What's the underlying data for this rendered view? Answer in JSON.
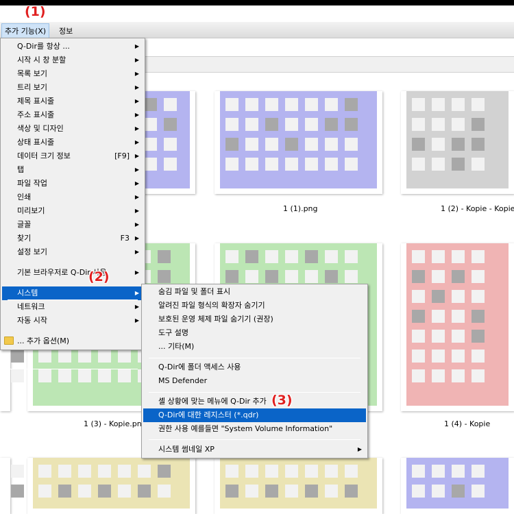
{
  "menubar": {
    "extras_label": "추가 기능(X)",
    "info_label": "정보"
  },
  "badges": {
    "one": "(1)",
    "two": "(2)",
    "three": "(3)"
  },
  "captions": {
    "c1": "1 (1).png",
    "c2": "1 (2) - Kopie - Kopie.",
    "c3": "1 (3) - Kopie.png",
    "c4": "1 (4) - Kopie"
  },
  "main_menu": {
    "items": [
      {
        "label": "Q-Dir를 항상 ...",
        "shortcut": "",
        "arrow": "▶"
      },
      {
        "label": "시작 시 창 분할",
        "shortcut": "",
        "arrow": "▶"
      },
      {
        "label": "목록 보기",
        "shortcut": "",
        "arrow": "▶"
      },
      {
        "label": "트리 보기",
        "shortcut": "",
        "arrow": "▶"
      },
      {
        "label": "제목 표시줄",
        "shortcut": "",
        "arrow": "▶"
      },
      {
        "label": "주소 표시줄",
        "shortcut": "",
        "arrow": "▶"
      },
      {
        "label": "색상 및 디자인",
        "shortcut": "",
        "arrow": "▶"
      },
      {
        "label": "상태 표시줄",
        "shortcut": "",
        "arrow": "▶"
      },
      {
        "label": "데이터 크기 정보",
        "shortcut": "[F9]",
        "arrow": "▶"
      },
      {
        "label": "탭",
        "shortcut": "",
        "arrow": "▶"
      },
      {
        "label": "파일 작업",
        "shortcut": "",
        "arrow": "▶"
      },
      {
        "label": "인쇄",
        "shortcut": "",
        "arrow": "▶"
      },
      {
        "label": "미리보기",
        "shortcut": "",
        "arrow": "▶"
      },
      {
        "label": "글꼴",
        "shortcut": "",
        "arrow": "▶"
      },
      {
        "label": "찾기",
        "shortcut": "F3",
        "arrow": "▶"
      },
      {
        "label": "설정 보기",
        "shortcut": "",
        "arrow": "▶"
      },
      {
        "label": "기본 브라우저로 Q-Dir 사용",
        "shortcut": "",
        "arrow": "▶"
      },
      {
        "label": "시스템",
        "shortcut": "",
        "arrow": "▶"
      },
      {
        "label": "네트워크",
        "shortcut": "",
        "arrow": "▶"
      },
      {
        "label": "자동 시작",
        "shortcut": "",
        "arrow": "▶"
      },
      {
        "label": "... 추가 옵션(M)",
        "shortcut": "",
        "arrow": ""
      }
    ]
  },
  "sub_menu": {
    "items": [
      {
        "label": "숨김 파일 및 폴더 표시",
        "arrow": ""
      },
      {
        "label": "알려진 파일 형식의 확장자 숨기기",
        "arrow": ""
      },
      {
        "label": "보호된 운영 체제 파일 숨기기 (권장)",
        "arrow": ""
      },
      {
        "label": "도구 설명",
        "arrow": ""
      },
      {
        "label": "... 기타(M)",
        "arrow": ""
      },
      {
        "label": "Q-Dir에 폴더 액세스 사용",
        "arrow": ""
      },
      {
        "label": "MS Defender",
        "arrow": ""
      },
      {
        "label": "셸 상황에 맞는 메뉴에 Q-Dir 추가",
        "arrow": ""
      },
      {
        "label": "Q-Dir에 대한 레지스터 (*.qdr)",
        "arrow": ""
      },
      {
        "label": "권한 사용 예를들면 \"System Volume Information\"",
        "arrow": ""
      },
      {
        "label": "시스템 썸네일 XP",
        "arrow": "▶"
      }
    ]
  },
  "colors": {
    "highlight": "#0a64c8",
    "badge": "#e02020",
    "purple": "#b4b4f0",
    "gray": "#d2d2d2",
    "green": "#bce6b4",
    "red": "#f0b4b4",
    "yellow": "#ebe4b4"
  }
}
